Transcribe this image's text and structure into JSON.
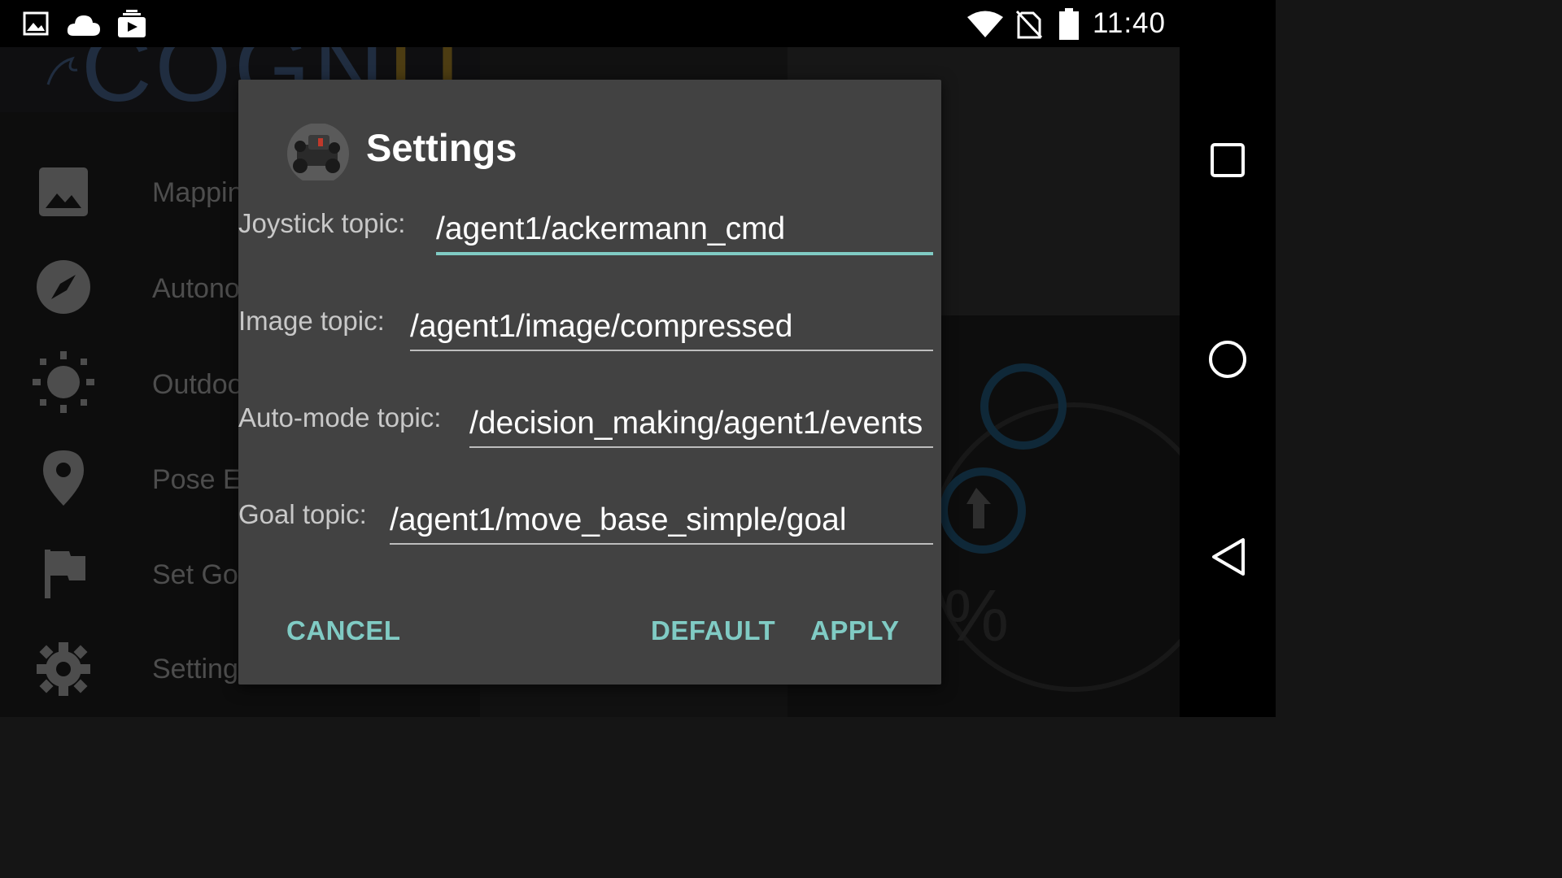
{
  "status_bar": {
    "time": "11:40",
    "left_icons": [
      "image-icon",
      "cloud-icon",
      "media-upload-icon"
    ],
    "right_icons": [
      "wifi-icon",
      "no-sim-icon",
      "battery-icon"
    ]
  },
  "background_app": {
    "drawer_items": [
      {
        "label": "Mappin",
        "icon": "image-icon"
      },
      {
        "label": "Autono",
        "icon": "compass-icon"
      },
      {
        "label": "Outdoo",
        "icon": "brightness-icon"
      },
      {
        "label": "Pose E",
        "icon": "location-pin-icon"
      },
      {
        "label": "Set Goa",
        "icon": "flag-icon"
      },
      {
        "label": "Setting",
        "icon": "gear-icon"
      }
    ]
  },
  "dialog": {
    "title": "Settings",
    "fields": [
      {
        "label": "Joystick topic:",
        "value": "/agent1/ackermann_cmd"
      },
      {
        "label": "Image topic:",
        "value": "/agent1/image/compressed"
      },
      {
        "label": "Auto-mode topic:",
        "value": "/decision_making/agent1/events"
      },
      {
        "label": "Goal topic:",
        "value": "/agent1/move_base_simple/goal"
      }
    ],
    "buttons": {
      "cancel": "CANCEL",
      "default": "DEFAULT",
      "apply": "APPLY"
    }
  },
  "colors": {
    "accent": "#80cbc4",
    "dialog_bg": "#424242",
    "status_bar_bg": "#000000"
  }
}
